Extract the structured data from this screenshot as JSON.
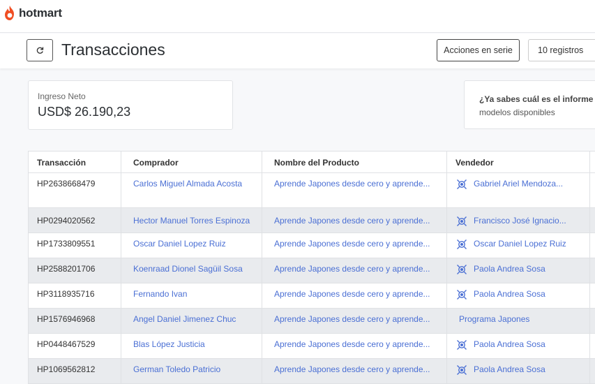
{
  "brand": {
    "name": "hotmart",
    "color": "#f04e23"
  },
  "header": {
    "title": "Transacciones",
    "bulk_actions_label": "Acciones en serie",
    "records_label": "10 registros"
  },
  "summary": {
    "net_income_label": "Ingreso Neto",
    "net_income_value": "USD$ 26.190,23"
  },
  "info_card": {
    "title": "¿Ya sabes cuál es el informe de",
    "subtitle": "modelos disponibles"
  },
  "table": {
    "columns": [
      "Transacción",
      "Comprador",
      "Nombre del Producto",
      "Vendedor"
    ],
    "rows": [
      {
        "id": "HP2638668479",
        "buyer": "Carlos Miguel Almada Acosta",
        "product": "Aprende Japones desde cero y aprende...",
        "seller": "Gabriel Ariel Mendoza...",
        "seller_icon": true
      },
      {
        "id": "HP0294020562",
        "buyer": "Hector Manuel Torres Espinoza",
        "product": "Aprende Japones desde cero y aprende...",
        "seller": "Francisco José Ignacio...",
        "seller_icon": true
      },
      {
        "id": "HP1733809551",
        "buyer": "Oscar Daniel Lopez Ruiz",
        "product": "Aprende Japones desde cero y aprende...",
        "seller": "Oscar Daniel Lopez Ruiz",
        "seller_icon": true
      },
      {
        "id": "HP2588201706",
        "buyer": "Koenraad Dionel Sagüil Sosa",
        "product": "Aprende Japones desde cero y aprende...",
        "seller": "Paola Andrea Sosa",
        "seller_icon": true
      },
      {
        "id": "HP3118935716",
        "buyer": "Fernando Ivan",
        "product": "Aprende Japones desde cero y aprende...",
        "seller": "Paola Andrea Sosa",
        "seller_icon": true
      },
      {
        "id": "HP1576946968",
        "buyer": "Angel Daniel Jimenez Chuc",
        "product": "Aprende Japones desde cero y aprende...",
        "seller": "Programa Japones",
        "seller_icon": false
      },
      {
        "id": "HP0448467529",
        "buyer": "Blas López Justicia",
        "product": "Aprende Japones desde cero y aprende...",
        "seller": "Paola Andrea Sosa",
        "seller_icon": true
      },
      {
        "id": "HP1069562812",
        "buyer": "German Toledo Patricio",
        "product": "Aprende Japones desde cero y aprende...",
        "seller": "Paola Andrea Sosa",
        "seller_icon": true
      }
    ]
  }
}
